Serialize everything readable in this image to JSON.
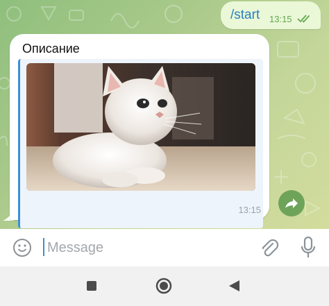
{
  "messages": {
    "outgoing": {
      "text": "/start",
      "time": "13:15",
      "status": "read"
    },
    "incoming": {
      "title": "Описание",
      "image_alt": "white kitten photo",
      "time": "13:15"
    }
  },
  "input": {
    "placeholder": "Message",
    "value": ""
  },
  "icons": {
    "emoji": "smiley-icon",
    "attach": "paperclip-icon",
    "mic": "microphone-icon",
    "share": "share-arrow-icon",
    "nav_recents": "square-icon",
    "nav_home": "circle-icon",
    "nav_back": "triangle-back-icon"
  },
  "colors": {
    "accent": "#3a8fd6",
    "outgoing_bubble": "#eaf8d8",
    "read_check": "#62a84e",
    "share_button": "#6ea35a"
  }
}
